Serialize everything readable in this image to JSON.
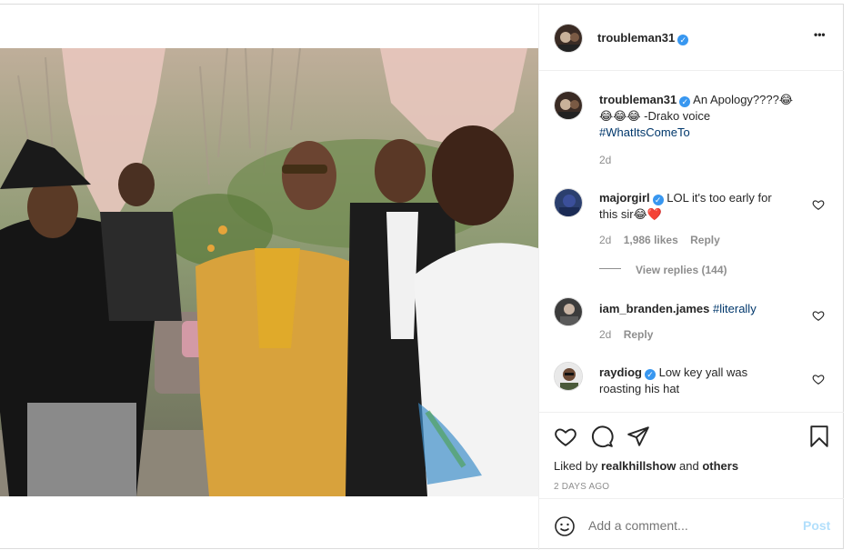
{
  "post": {
    "author": "troubleman31",
    "more_label": "•••"
  },
  "caption": {
    "author": "troubleman31",
    "text_line1": "An Apology????😂",
    "text_line2": "😂😂😂 -Drako voice",
    "hashtag": "#WhatItsComeTo",
    "time": "2d"
  },
  "comments": [
    {
      "author": "majorgirl",
      "verified": true,
      "text_a": "LOL it's too early for",
      "text_b": "this sir😂❤️",
      "time": "2d",
      "likes": "1,986 likes",
      "reply": "Reply",
      "view_replies": "View replies (144)"
    },
    {
      "author": "iam_branden.james",
      "verified": false,
      "text_a": "#literally",
      "time": "2d",
      "reply": "Reply"
    },
    {
      "author": "raydiog",
      "verified": true,
      "text_a": "Low key yall was",
      "text_b": "roasting his hat"
    }
  ],
  "footer": {
    "liked_by_prefix": "Liked by ",
    "liked_by_user": "realkhillshow",
    "liked_by_and": " and ",
    "liked_by_others": "others",
    "date": "2 DAYS AGO",
    "add_comment_placeholder": "Add a comment...",
    "post_label": "Post"
  },
  "colors": {
    "verified": "#3897f0",
    "hashtag": "#00376b",
    "heart": "#ed4956",
    "post_disabled": "#b2dffc"
  },
  "icons": [
    "heart-icon",
    "comment-icon",
    "share-icon",
    "bookmark-icon",
    "emoji-icon",
    "more-icon",
    "verified-icon"
  ]
}
